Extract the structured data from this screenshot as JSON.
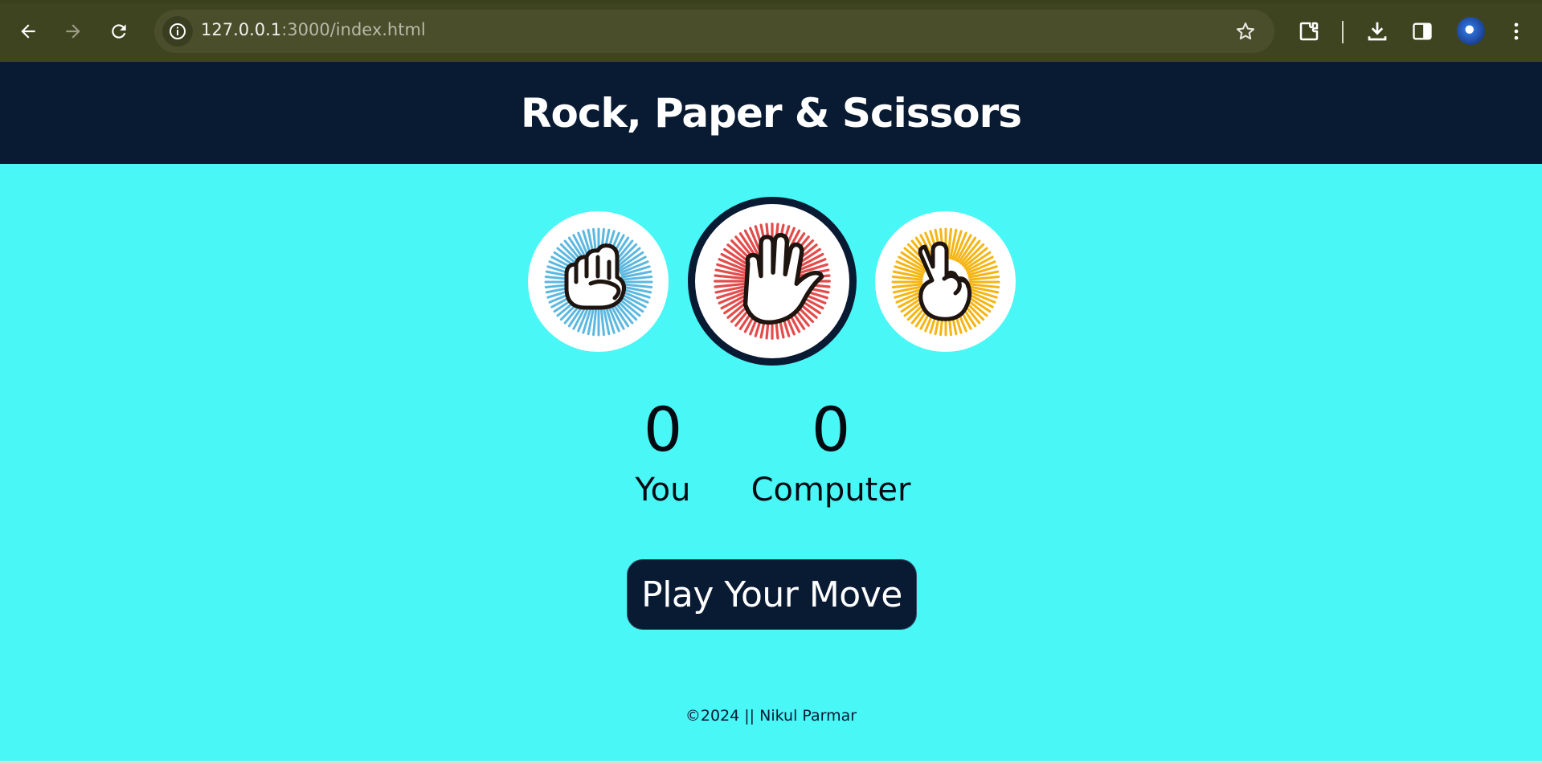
{
  "browser": {
    "url_host": "127.0.0.1",
    "url_path": ":3000/index.html",
    "icons": [
      "back-arrow-icon",
      "forward-arrow-icon",
      "reload-icon",
      "site-info-icon",
      "bookmark-star-icon",
      "extensions-icon",
      "download-icon",
      "side-panel-icon",
      "profile-avatar",
      "more-menu-icon"
    ]
  },
  "header": {
    "title": "Rock, Paper & Scissors"
  },
  "choices": [
    {
      "id": "rock",
      "color": "#5cb8e0",
      "icon": "fist-icon"
    },
    {
      "id": "paper",
      "color": "#e44c4c",
      "icon": "open-hand-icon"
    },
    {
      "id": "scissors",
      "color": "#f5b512",
      "icon": "peace-hand-icon"
    }
  ],
  "scores": {
    "user": {
      "value": "0",
      "label": "You"
    },
    "computer": {
      "value": "0",
      "label": "Computer"
    }
  },
  "message": {
    "text": "Play Your Move"
  },
  "footer": {
    "text": "©2024 || Nikul Parmar"
  },
  "colors": {
    "background": "#49f7f6",
    "header": "#091a33",
    "chrome": "#3f4420"
  }
}
